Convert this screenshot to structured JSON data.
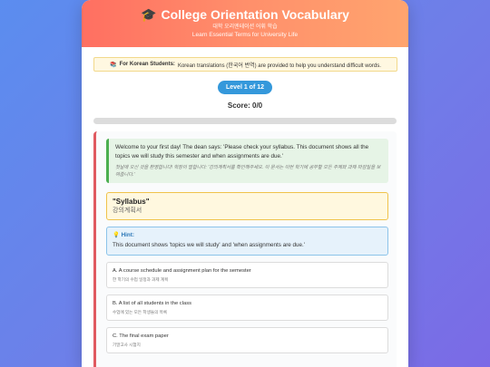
{
  "header": {
    "title": "College Orientation Vocabulary",
    "subtitle_kr": "대학 오리엔테이션 어휘 학습",
    "subtitle_en": "Learn Essential Terms for University Life",
    "icon": "graduation-cap-icon"
  },
  "notice": {
    "icon": "books-icon",
    "label": "For Korean Students:",
    "text": "Korean translations (한국어 번역) are provided to help you understand difficult words."
  },
  "level": {
    "label": "Level 1 of 12"
  },
  "score": {
    "label": "Score: 0/0"
  },
  "progress": {
    "fraction": 0.0
  },
  "question": {
    "story_en": "Welcome to your first day! The dean says: 'Please check your syllabus. This document shows all the topics we will study this semester and when assignments are due.'",
    "story_kr": "첫날에 오신 것을 환영합니다! 학장이 말합니다: '강의계획서를 확인해주세요. 이 문서는 이번 학기에 공부할 모든 주제와 과제 마감일을 보여줍니다.'",
    "term": "\"Syllabus\"",
    "term_kr": "강의계획서",
    "hint_title": "Hint:",
    "hint_icon": "lightbulb-icon",
    "hint_text": "This document shows 'topics we will study' and 'when assignments are due.'",
    "options": [
      {
        "en": "A. A course schedule and assignment plan for the semester",
        "kr": "한 학기의 수업 일정과 과제 계획"
      },
      {
        "en": "B. A list of all students in the class",
        "kr": "수업에 있는 모든 학생들의 목록"
      },
      {
        "en": "C. The final exam paper",
        "kr": "기말고사 시험지"
      }
    ]
  },
  "colors": {
    "header_start": "#ff6f61",
    "header_end": "#ffa46e",
    "accent_blue": "#3498db",
    "story_green": "#4caf50",
    "card_border_red": "#e05a60"
  }
}
